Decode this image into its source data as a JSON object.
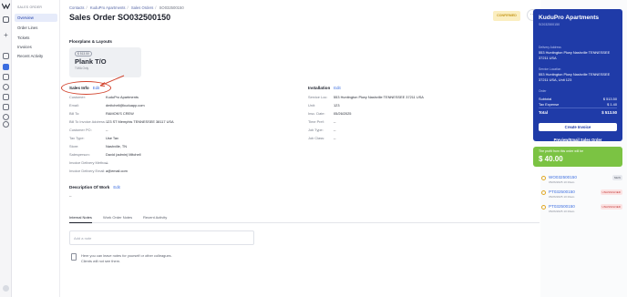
{
  "colors": {
    "accent": "#1f3ba8",
    "profit": "#7bc343",
    "unassigned": "#c63b3b",
    "status": "#fbeec0",
    "annotation": "#d2452f"
  },
  "rail_icons": [
    "logo-icon",
    "share-icon",
    "plus-icon",
    "home-icon",
    "users-icon",
    "grid-icon",
    "cart-icon",
    "clipboard-icon",
    "box-icon",
    "invoice-icon",
    "person-icon",
    "settings-icon"
  ],
  "subnav": {
    "header": "SALES ORDER",
    "items": [
      {
        "label": "Overview",
        "active": true
      },
      {
        "label": "Order Lines"
      },
      {
        "label": "Tickets"
      },
      {
        "label": "Invoices"
      },
      {
        "label": "Recent Activity"
      }
    ]
  },
  "breadcrumb": [
    "Contacts",
    "KuduPro Apartments",
    "Sales Orders",
    "SO032500150"
  ],
  "page_title": "Sales Order SO032500150",
  "status_button": "CONFIRMED",
  "floorplans": {
    "heading": "Floorplans & Layouts",
    "plan": {
      "price": "$ 513.50",
      "name": "Plank T/O",
      "sub": "T/WA Only"
    }
  },
  "sales_info": {
    "heading": "Sales Info",
    "edit": "Edit",
    "rows": [
      {
        "k": "Customer:",
        "v": "KuduPro Apartments"
      },
      {
        "k": "Email:",
        "v": "dmitchell@kuduapp.com"
      },
      {
        "k": "Bill To:",
        "v": "RAMON'S CREW"
      },
      {
        "k": "Bill To Invoice Address:",
        "v": "123 ST Memphis TENNESSEE 38117 USA"
      },
      {
        "k": "Customer PO:",
        "v": "--"
      },
      {
        "k": "Tax Type:",
        "v": "Use Tax"
      },
      {
        "k": "Store:",
        "v": "Nashville, TN"
      },
      {
        "k": "Salesperson:",
        "v": "David (admin) Mitchell"
      },
      {
        "k": "Invoice Delivery Method:",
        "v": "--"
      },
      {
        "k": "Invoice Delivery Email:",
        "v": "a@email.com"
      }
    ]
  },
  "installation": {
    "heading": "Installation",
    "edit": "Edit",
    "rows": [
      {
        "k": "Service Loc:",
        "v": "553 Huntington Pkwy Nashville TENNESSEE 37211 USA"
      },
      {
        "k": "Unit:",
        "v": "123"
      },
      {
        "k": "Insc. Date:",
        "v": "05/26/2025"
      },
      {
        "k": "Time Pref:",
        "v": "--"
      },
      {
        "k": "Job Type:",
        "v": "--"
      },
      {
        "k": "Job Class:",
        "v": "--"
      }
    ]
  },
  "description": {
    "heading": "Description Of Work",
    "edit": "Edit",
    "value": "--"
  },
  "notes": {
    "tabs": [
      "Internal Notes",
      "Work Order Notes",
      "Recent Activity"
    ],
    "placeholder": "Add a note",
    "empty_line1": "Here you can leave notes for yourself or other colleagues.",
    "empty_line2": "Clients will not see them."
  },
  "summary": {
    "name": "KuduPro Apartments",
    "order": "SO032500150",
    "delivery_label": "Delivery Address",
    "delivery_address": "553 Huntington Pkwy Nashville TENNESSEE 37211 USA",
    "service_label": "Service Location",
    "service_address": "553 Huntington Pkwy Nashville TENNESSEE 37211 USA, Unit 123",
    "order_label": "Order",
    "subtotal_label": "Subtotal",
    "subtotal": "$ 513.50",
    "tax_label": "Tax Expense",
    "tax": "$ 1.40",
    "total_label": "Total",
    "total": "$ 513.50",
    "create_invoice": "Create Invoice",
    "preview": "Preview/Email Sales Order"
  },
  "profit": {
    "text": "The profit from this order will be",
    "amount": "$ 40.00"
  },
  "orders": [
    {
      "code": "WO032500150",
      "ts": "05/26/2025 10:19am",
      "badge": "NEW",
      "badge_type": "new"
    },
    {
      "code": "PT032500150",
      "ts": "05/26/2025 10:19am",
      "badge": "UNASSIGNED",
      "badge_type": "un"
    },
    {
      "code": "PT032500150",
      "ts": "05/26/2025 10:19am",
      "badge": "UNASSIGNED",
      "badge_type": "un"
    }
  ]
}
